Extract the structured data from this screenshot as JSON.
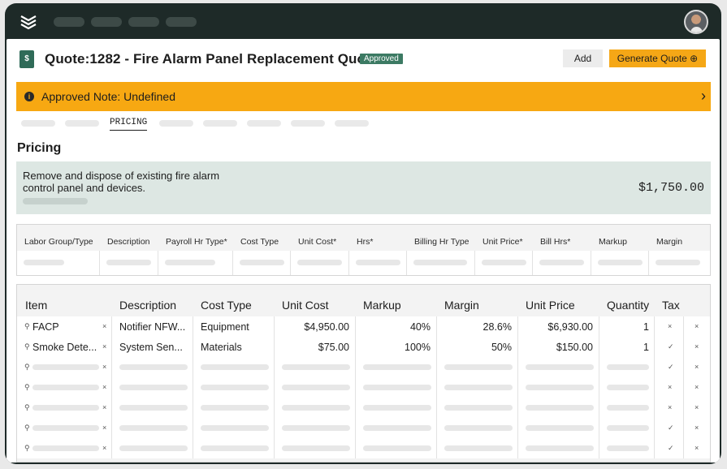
{
  "header": {
    "title": "Quote:1282 - Fire Alarm Panel Replacement Quote",
    "status_badge": "Approved",
    "add_label": "Add",
    "generate_label": "Generate Quote ⊕"
  },
  "banner": {
    "text": "Approved Note: Undefined"
  },
  "tabs": {
    "active_label": "PRICING"
  },
  "pricing": {
    "section_title": "Pricing",
    "description": "Remove and dispose of existing fire alarm control panel and devices.",
    "total": "$1,750.00"
  },
  "labor_table": {
    "headers": [
      "Labor Group/Type",
      "Description",
      "Payroll Hr Type*",
      "Cost Type",
      "Unit Cost*",
      "Hrs*",
      "Billing Hr Type",
      "Unit Price*",
      "Bill Hrs*",
      "Markup",
      "Margin"
    ]
  },
  "items_table": {
    "headers": [
      "Item",
      "Description",
      "Cost Type",
      "Unit Cost",
      "Markup",
      "Margin",
      "Unit Price",
      "Quantity",
      "Tax"
    ],
    "rows": [
      {
        "item": "FACP",
        "description": "Notifier NFW...",
        "cost_type": "Equipment",
        "unit_cost": "$4,950.00",
        "markup": "40%",
        "margin": "28.6%",
        "unit_price": "$6,930.00",
        "quantity": "1",
        "tax": "×"
      },
      {
        "item": "Smoke Dete...",
        "description": "System Sen...",
        "cost_type": "Materials",
        "unit_cost": "$75.00",
        "markup": "100%",
        "margin": "50%",
        "unit_price": "$150.00",
        "quantity": "1",
        "tax": "✓"
      }
    ],
    "placeholder_tax": [
      "✓",
      "×",
      "×",
      "✓",
      "✓"
    ]
  },
  "colors": {
    "accent": "#f5a716",
    "brand_green": "#3c7a63",
    "dark_frame": "#1e2a28",
    "pricing_bg": "#dde7e3"
  }
}
